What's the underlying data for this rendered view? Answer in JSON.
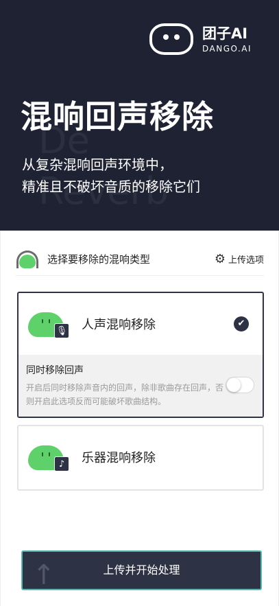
{
  "brand": {
    "name": "团子AI",
    "subtitle": "DANGO.AI"
  },
  "hero": {
    "title": "混响回声移除",
    "subtitle_line1": "从复杂混响回声环境中，",
    "subtitle_line2": "精准且不破坏音质的移除它们",
    "bg_word1": "De",
    "bg_word2": "Reverb"
  },
  "topbar": {
    "title": "选择要移除的混响类型",
    "upload_options": "上传选项"
  },
  "options": [
    {
      "label": "人声混响移除",
      "selected": true,
      "badge_icon": "microphone-icon",
      "extra": {
        "title": "同时移除回声",
        "description": "开启后同时移除声音内的回声，除非歌曲存在回声，否则开启此选项反而可能破坏歌曲结构。",
        "toggle_on": false
      }
    },
    {
      "label": "乐器混响移除",
      "selected": false,
      "badge_icon": "music-note-icon"
    }
  ],
  "action_button": "上传并开始处理",
  "colors": {
    "hero_bg": "#1e2233",
    "accent_green": "#5ed16a",
    "primary_dark": "#2d3244",
    "button_border": "#54b8b0"
  }
}
